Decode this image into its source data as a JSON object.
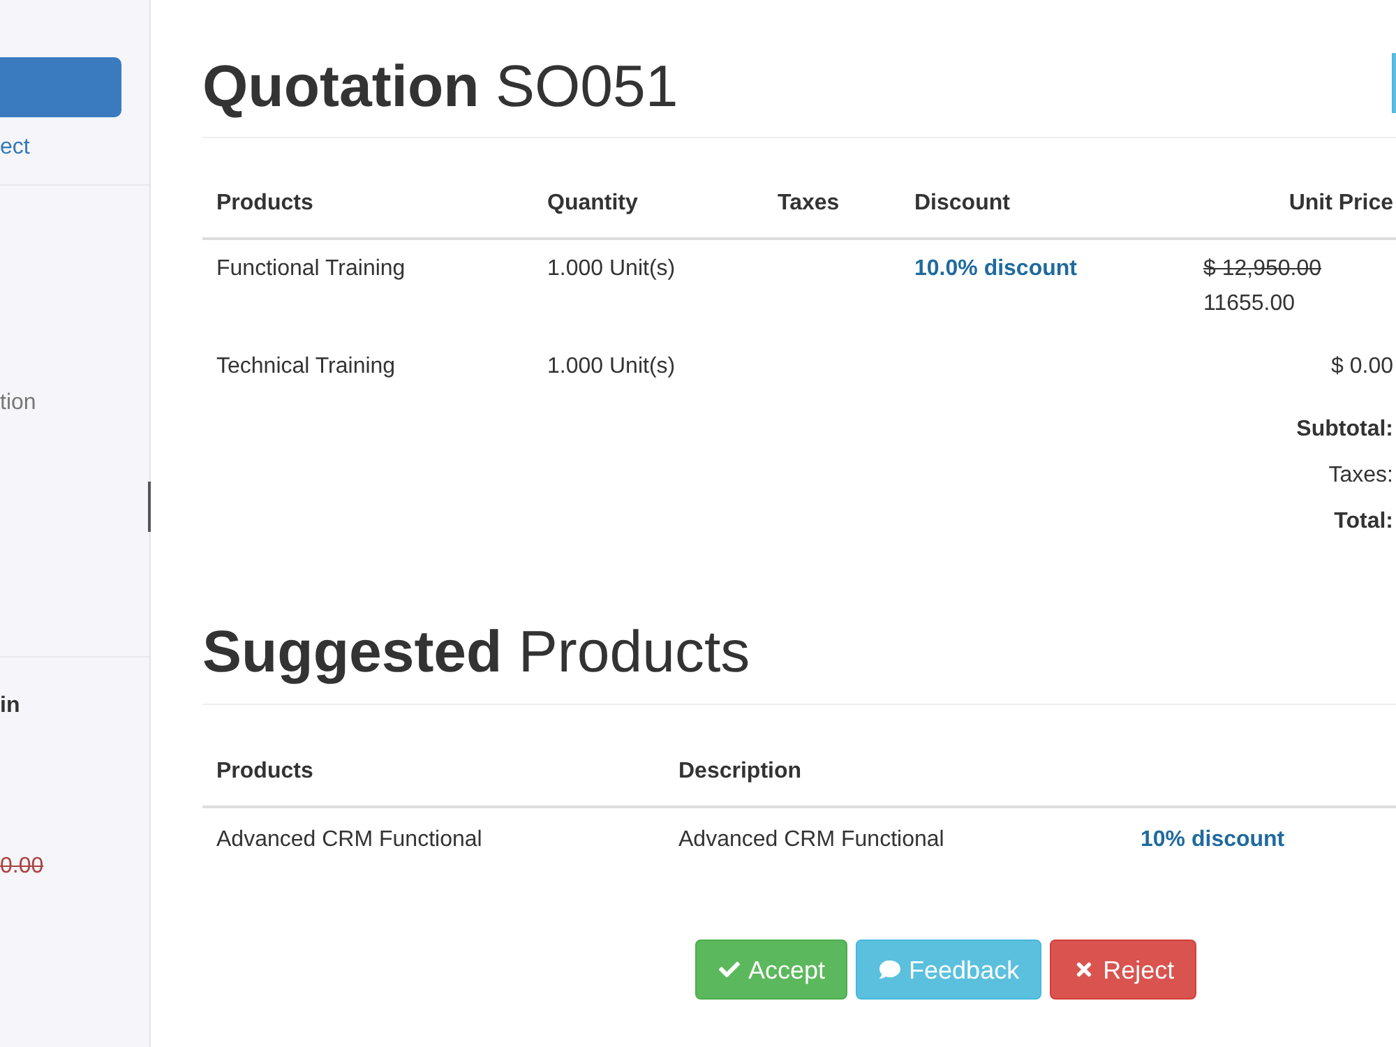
{
  "sidebar": {
    "link": "ect",
    "label": "tion",
    "heading": "in",
    "old_price": "0.00"
  },
  "quotation": {
    "title": "**Quotation** SO051",
    "columns": [
      "Products",
      "Quantity",
      "Taxes",
      "Discount",
      "Unit Price"
    ],
    "rows": [
      {
        "product": "Functional Training",
        "quantity": "1.000 Unit(s)",
        "discount": "10.0% discount",
        "old_price": "$ 12,950.00",
        "unit_price": "11655.00"
      },
      {
        "product": "Technical Training",
        "quantity": "1.000 Unit(s)",
        "unit_price": "$ 0.00"
      }
    ],
    "totals": [
      {
        "label": "Subtotal:",
        "bold": true
      },
      {
        "label": "Taxes:",
        "bold": false
      },
      {
        "label": "Total:",
        "bold": true
      }
    ]
  },
  "suggested": {
    "title": "**Suggested** Products",
    "columns": [
      "Products",
      "Description"
    ],
    "rows": [
      {
        "product": "Advanced CRM Functional",
        "description": "Advanced CRM Functional",
        "discount": "10% discount"
      }
    ]
  },
  "actions": [
    {
      "kind": "accept",
      "label": "Accept"
    },
    {
      "kind": "feedback",
      "label": "Feedback"
    },
    {
      "kind": "reject",
      "label": "Reject"
    }
  ]
}
